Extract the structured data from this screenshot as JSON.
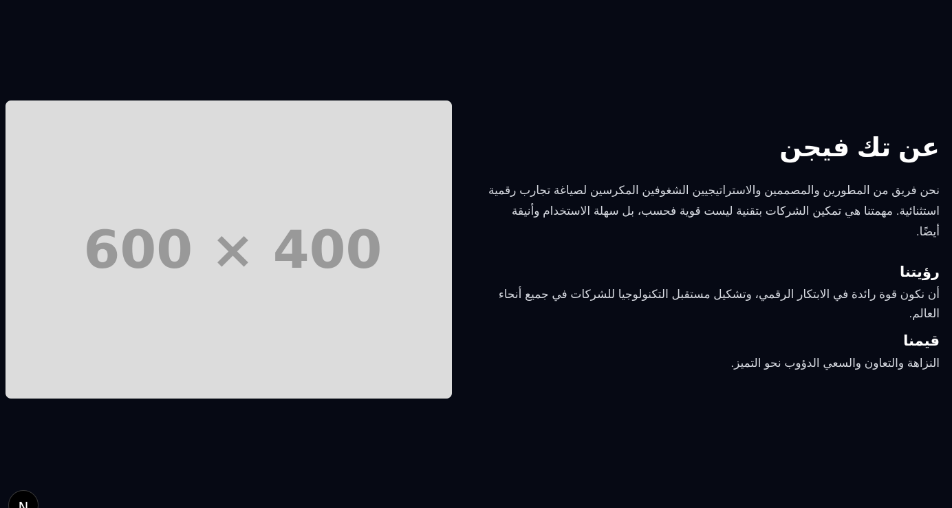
{
  "image_placeholder": {
    "label": "600 × 400"
  },
  "about": {
    "title": "عن تك فيجن",
    "description": "نحن فريق من المطورين والمصممين والاستراتيجيين الشغوفين المكرسين لصياغة تجارب رقمية استثنائية. مهمتنا هي تمكين الشركات بتقنية ليست قوية فحسب، بل سهلة الاستخدام وأنيقة أيضًا.",
    "vision": {
      "heading": "رؤيتنا",
      "text": "أن نكون قوة رائدة في الابتكار الرقمي، وتشكيل مستقبل التكنولوجيا للشركات في جميع أنحاء العالم."
    },
    "values": {
      "heading": "قيمنا",
      "text": "النزاهة والتعاون والسعي الدؤوب نحو التميز."
    }
  },
  "dev_badge": {
    "letter": "N"
  },
  "colors": {
    "background": "#060914",
    "placeholder_bg": "#dcdcdc",
    "placeholder_text": "#999999",
    "text_primary": "#ffffff",
    "text_secondary": "#d8dbe2"
  }
}
